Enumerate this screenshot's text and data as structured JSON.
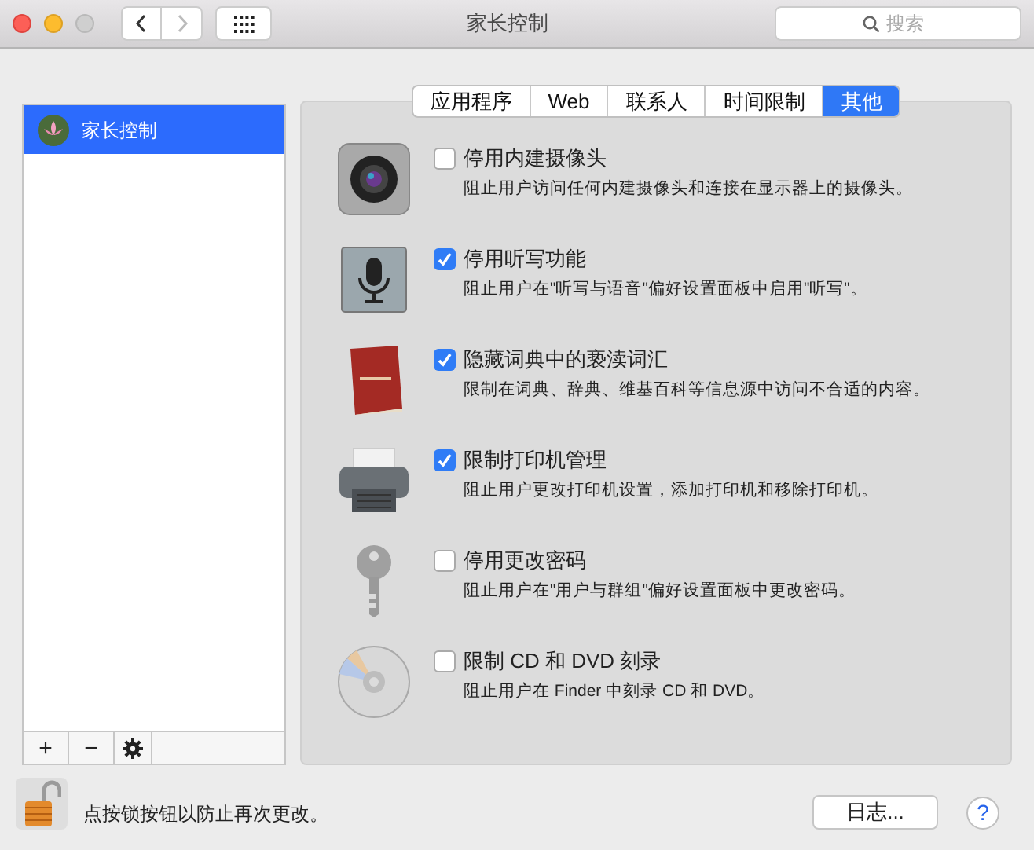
{
  "window": {
    "title": "家长控制"
  },
  "search": {
    "placeholder": "搜索"
  },
  "sidebar": {
    "items": [
      {
        "label": "家长控制",
        "selected": true
      }
    ]
  },
  "tabs": [
    {
      "label": "应用程序",
      "selected": false
    },
    {
      "label": "Web",
      "selected": false
    },
    {
      "label": "联系人",
      "selected": false
    },
    {
      "label": "时间限制",
      "selected": false
    },
    {
      "label": "其他",
      "selected": true
    }
  ],
  "options": [
    {
      "title": "停用内建摄像头",
      "description": "阻止用户访问任何内建摄像头和连接在显示器上的摄像头。",
      "checked": false
    },
    {
      "title": "停用听写功能",
      "description": "阻止用户在\"听写与语音\"偏好设置面板中启用\"听写\"。",
      "checked": true
    },
    {
      "title": "隐藏词典中的亵渎词汇",
      "description": "限制在词典、辞典、维基百科等信息源中访问不合适的内容。",
      "checked": true
    },
    {
      "title": "限制打印机管理",
      "description": "阻止用户更改打印机设置，添加打印机和移除打印机。",
      "checked": true
    },
    {
      "title": "停用更改密码",
      "description": "阻止用户在\"用户与群组\"偏好设置面板中更改密码。",
      "checked": false
    },
    {
      "title": "限制 CD 和 DVD 刻录",
      "description": "阻止用户在 Finder 中刻录 CD 和 DVD。",
      "checked": false
    }
  ],
  "list_toolbar": [
    "+",
    "−"
  ],
  "lock_text": "点按锁按钮以防止再次更改。",
  "log_button": "日志...",
  "help_button": "?"
}
